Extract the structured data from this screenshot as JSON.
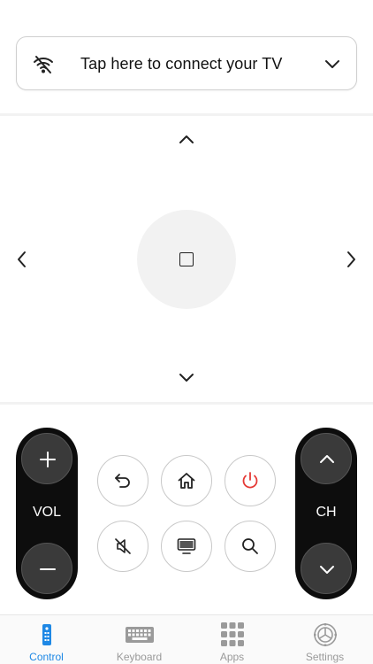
{
  "connect": {
    "label": "Tap here to connect your TV",
    "wifi_icon": "wifi-off-icon",
    "chevron_icon": "chevron-down-icon"
  },
  "dpad": {
    "up_icon": "chevron-up-icon",
    "down_icon": "chevron-down-icon",
    "left_icon": "chevron-left-icon",
    "right_icon": "chevron-right-icon",
    "ok_icon": "square-icon"
  },
  "volume": {
    "label": "VOL",
    "plus_icon": "plus-icon",
    "minus_icon": "minus-icon"
  },
  "channel": {
    "label": "CH",
    "up_icon": "chevron-up-icon",
    "down_icon": "chevron-down-icon"
  },
  "controls": {
    "back_icon": "back-icon",
    "home_icon": "home-icon",
    "power_icon": "power-icon",
    "mute_icon": "mute-icon",
    "input_icon": "tv-icon",
    "search_icon": "search-icon"
  },
  "colors": {
    "accent": "#1e88e5",
    "power": "#e53935",
    "rocker": "#0d0d0d",
    "rocker_button": "#3a3a3a"
  },
  "tabs": [
    {
      "label": "Control",
      "icon": "remote-icon",
      "active": true
    },
    {
      "label": "Keyboard",
      "icon": "keyboard-icon",
      "active": false
    },
    {
      "label": "Apps",
      "icon": "apps-grid-icon",
      "active": false
    },
    {
      "label": "Settings",
      "icon": "gear-icon",
      "active": false
    }
  ]
}
